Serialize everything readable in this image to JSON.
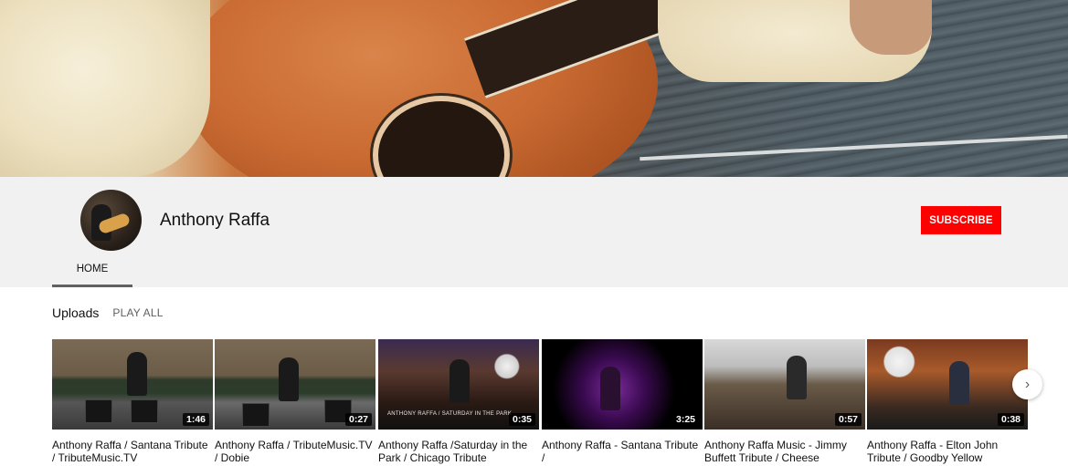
{
  "channel": {
    "name": "Anthony Raffa",
    "subscribe_label": "SUBSCRIBE",
    "tabs": [
      {
        "label": "HOME",
        "selected": true
      }
    ]
  },
  "uploads": {
    "title": "Uploads",
    "play_all_label": "PLAY ALL",
    "videos": [
      {
        "title": "Anthony Raffa / Santana Tribute / TributeMusic.TV",
        "duration": "1:46"
      },
      {
        "title": "Anthony Raffa / TributeMusic.TV / Dobie",
        "duration": "0:27"
      },
      {
        "title": "Anthony Raffa /Saturday in the Park / Chicago Tribute",
        "duration": "0:35",
        "thumbnail_caption": "ANTHONY RAFFA / SATURDAY IN THE PARK"
      },
      {
        "title": "Anthony Raffa - Santana Tribute /",
        "duration": "3:25"
      },
      {
        "title": "Anthony Raffa Music - Jimmy Buffett Tribute / Cheese",
        "duration": "0:57"
      },
      {
        "title": "Anthony Raffa - Elton John Tribute / Goodby Yellow",
        "duration": "0:38"
      }
    ]
  },
  "icons": {
    "next": "chevron-right-icon"
  },
  "colors": {
    "subscribe": "#ff0000",
    "header_bg": "#f1f1f1"
  }
}
